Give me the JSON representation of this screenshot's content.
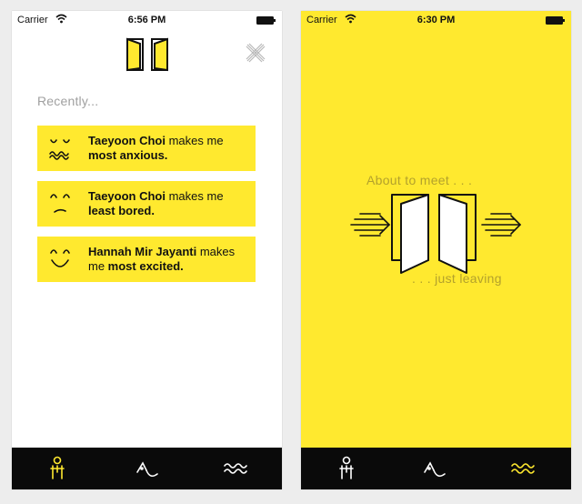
{
  "colors": {
    "accent_yellow": "#ffe92f",
    "tabbar": "#0a0a0a",
    "heading_gray": "#a0a0a0",
    "hint_text": "#b3a12c"
  },
  "left_screen": {
    "status": {
      "carrier": "Carrier",
      "time": "6:56 PM"
    },
    "heading": "Recently...",
    "cards": [
      {
        "name": "Taeyoon Choi",
        "middle": " makes me ",
        "feeling": "most anxious.",
        "face": "anxious-face-icon"
      },
      {
        "name": "Taeyoon Choi",
        "middle": " makes me ",
        "feeling": "least bored.",
        "face": "bored-face-icon"
      },
      {
        "name": "Hannah Mir Jayanti",
        "middle": " makes me ",
        "feeling": "most excited.",
        "face": "excited-face-icon"
      }
    ],
    "tabs": [
      {
        "icon": "person-icon",
        "active": true
      },
      {
        "icon": "wave-face-icon",
        "active": false
      },
      {
        "icon": "squiggle-icon",
        "active": false
      }
    ]
  },
  "right_screen": {
    "status": {
      "carrier": "Carrier",
      "time": "6:30 PM"
    },
    "hint_top": "About to meet . . .",
    "hint_bottom": ". . . just leaving",
    "tabs": [
      {
        "icon": "person-icon",
        "active": false
      },
      {
        "icon": "wave-face-icon",
        "active": false
      },
      {
        "icon": "squiggle-icon",
        "active": true
      }
    ]
  }
}
